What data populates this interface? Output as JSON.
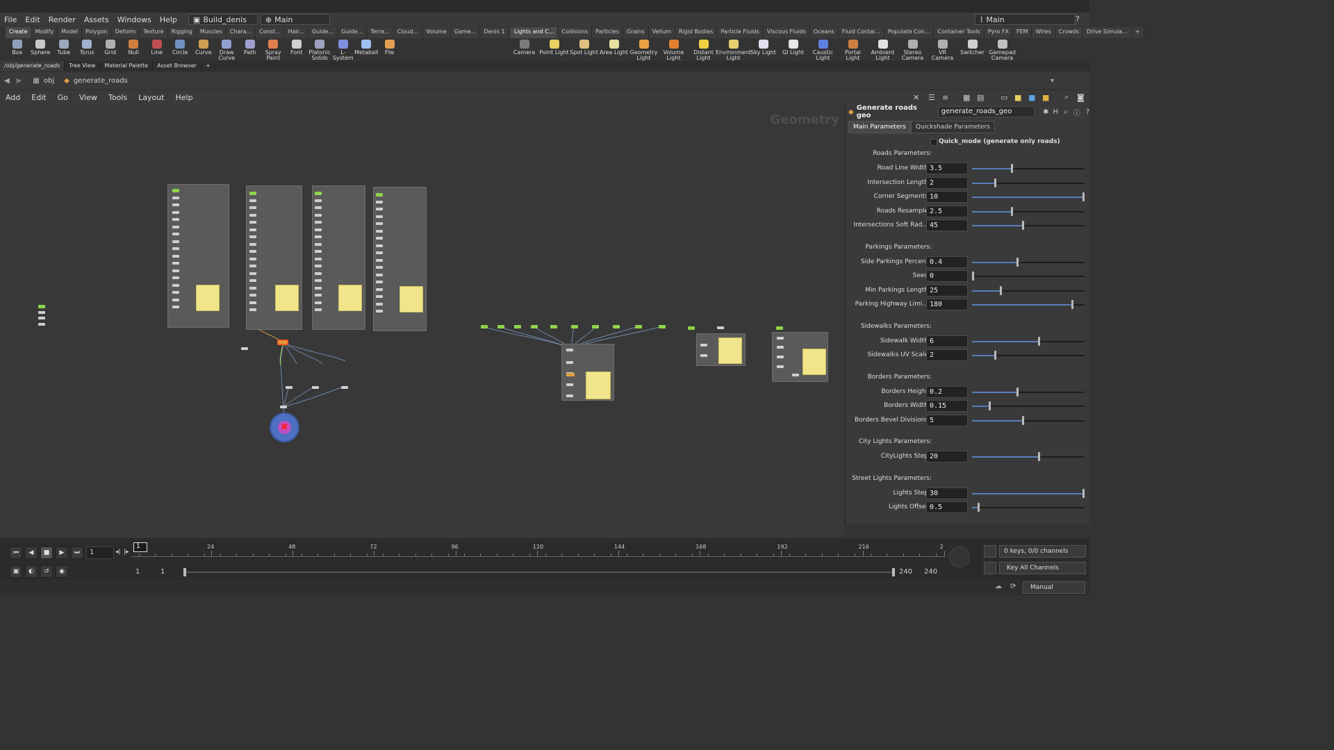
{
  "menu": [
    "File",
    "Edit",
    "Render",
    "Assets",
    "Windows",
    "Help"
  ],
  "desktop": {
    "name": "Build_denis",
    "context": "Main"
  },
  "right_desktop": "Main",
  "shelf_tabs_left": [
    "Create",
    "Modify",
    "Model",
    "Polygon",
    "Deform",
    "Texture",
    "Rigging",
    "Muscles",
    "Chara...",
    "Const...",
    "Hair...",
    "Guide...",
    "Guide...",
    "Terra...",
    "Cloud...",
    "Volume",
    "Game...",
    "Denis 1"
  ],
  "shelf_tabs_right": [
    "Lights and C...",
    "Collisions",
    "Particles",
    "Grains",
    "Vellum",
    "Rigid Bodies",
    "Particle Fluids",
    "Viscous Fluids",
    "Oceans",
    "Fluid Contai...",
    "Populate Con...",
    "Container Tools",
    "Pyro FX",
    "FEM",
    "Wires",
    "Crowds",
    "Drive Simula..."
  ],
  "tools_left": [
    "Box",
    "Sphere",
    "Tube",
    "Torus",
    "Grid",
    "Null",
    "Line",
    "Circle",
    "Curve",
    "Draw Curve",
    "Path",
    "Spray Paint",
    "Font",
    "Platonic Solids",
    "L-System",
    "Metaball",
    "File"
  ],
  "tools_right": [
    "Camera",
    "Point Light",
    "Spot Light",
    "Area Light",
    "Geometry Light",
    "Volume Light",
    "Distant Light",
    "Environment Light",
    "Sky Light",
    "GI Light",
    "Caustic Light",
    "Portal Light",
    "Ambient Light",
    "Stereo Camera",
    "VR Camera",
    "Switcher",
    "Gamepad Camera"
  ],
  "pane_tabs": [
    "/obj/generate_roads",
    "Tree View",
    "Material Palette",
    "Asset Browser"
  ],
  "path": {
    "root": "obj",
    "node": "generate_roads"
  },
  "net_menu": [
    "Add",
    "Edit",
    "Go",
    "View",
    "Tools",
    "Layout",
    "Help"
  ],
  "net_watermark": "Geometry",
  "params": {
    "node_type": "Generate roads geo",
    "node_name": "generate_roads_geo",
    "tabs": [
      "Main Parameters",
      "Quickshade Parameters"
    ],
    "quick_mode": "Quick_mode (generate only roads)",
    "sections": [
      {
        "title": "Roads Parameters:",
        "rows": [
          {
            "label": "Road Line Width",
            "value": "3.5",
            "fill": 0.35
          },
          {
            "label": "Intersection Length",
            "value": "2",
            "fill": 0.2
          },
          {
            "label": "Corner Segments",
            "value": "10",
            "fill": 1.0
          },
          {
            "label": "Roads Resample",
            "value": "2.5",
            "fill": 0.35
          },
          {
            "label": "Intersections Soft Rad...",
            "value": "45",
            "fill": 0.45
          }
        ]
      },
      {
        "title": "Parkings Parameters:",
        "rows": [
          {
            "label": "Side Parkings Percent",
            "value": "0.4",
            "fill": 0.4
          },
          {
            "label": "Seed",
            "value": "0",
            "fill": 0.0
          },
          {
            "label": "Min Parkings Length",
            "value": "25",
            "fill": 0.25
          },
          {
            "label": "Parking Highway Limi...",
            "value": "180",
            "fill": 0.9
          }
        ]
      },
      {
        "title": "Sidewalks Parameters:",
        "rows": [
          {
            "label": "Sidewalk Width",
            "value": "6",
            "fill": 0.6
          },
          {
            "label": "Sidewalks UV Scale",
            "value": "2",
            "fill": 0.2
          }
        ]
      },
      {
        "title": "Borders Parameters:",
        "rows": [
          {
            "label": "Borders Height",
            "value": "0.2",
            "fill": 0.4
          },
          {
            "label": "Borders Width",
            "value": "0.15",
            "fill": 0.15
          },
          {
            "label": "Borders Bevel Divisions",
            "value": "5",
            "fill": 0.45
          }
        ]
      },
      {
        "title": "City Lights Parameters:",
        "rows": [
          {
            "label": "CityLights Step",
            "value": "20",
            "fill": 0.6
          }
        ]
      },
      {
        "title": "Street Lights Parameters:",
        "rows": [
          {
            "label": "Lights Step",
            "value": "30",
            "fill": 1.0
          },
          {
            "label": "Lights Offset",
            "value": "0.5",
            "fill": 0.05
          }
        ]
      }
    ]
  },
  "timeline": {
    "frame": "1",
    "ticks": [
      "24",
      "48",
      "72",
      "96",
      "120",
      "144",
      "168",
      "192",
      "216",
      "2"
    ],
    "current": "1",
    "range_start": "1",
    "range_start2": "1",
    "range_end": "240",
    "range_end2": "240",
    "keys": "0 keys, 0/0 channels",
    "key_mode": "Key All Channels",
    "update": "Manual"
  }
}
